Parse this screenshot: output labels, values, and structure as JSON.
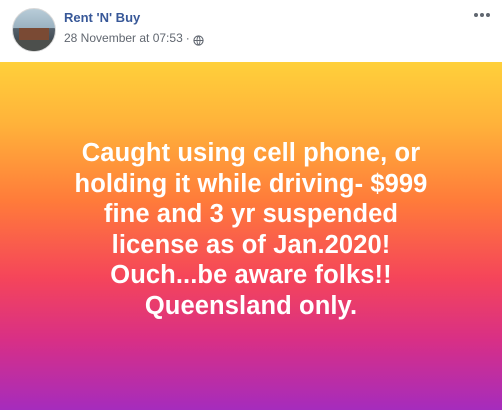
{
  "post": {
    "page_name": "Rent 'N' Buy",
    "timestamp": "28 November at 07:53",
    "separator": "·",
    "privacy_icon": "globe-icon",
    "more_icon": "more-options-icon"
  },
  "banner": {
    "lines": [
      "Caught using cell phone, or",
      "holding it while driving- $999",
      "fine and 3 yr suspended",
      "license as of Jan.2020!",
      "Ouch...be aware folks!!",
      "Queensland only."
    ],
    "gradient_colors": [
      "#ffd03a",
      "#ff7b3a",
      "#f5455a",
      "#d82f86",
      "#a52cbd"
    ],
    "text_color": "#ffffff"
  },
  "colors": {
    "page_name": "#385898",
    "meta_text": "#616770"
  }
}
